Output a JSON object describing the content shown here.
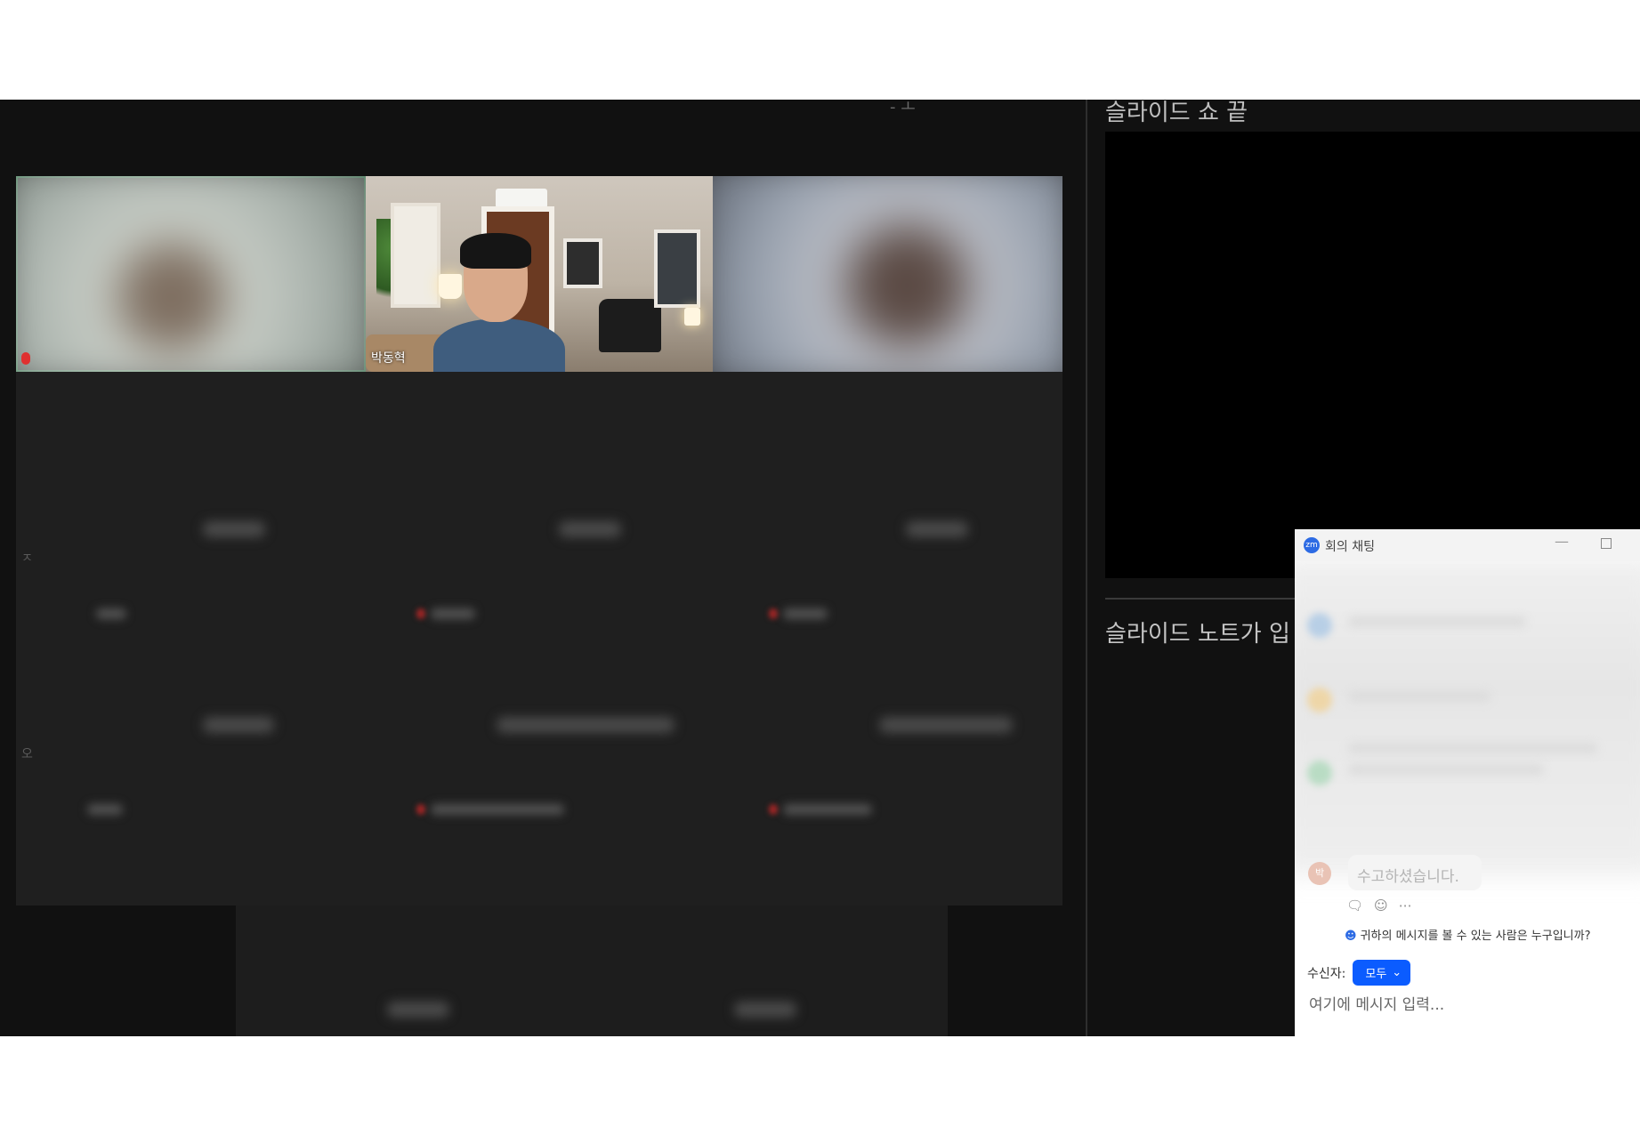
{
  "gallery": {
    "top_fragment": "- ㅗ",
    "participants": [
      {
        "name": "박동혁"
      }
    ],
    "side_marks": [
      "ㅈ",
      "오"
    ]
  },
  "presenter": {
    "end_title": "슬라이드 쇼 끝",
    "notes_title": "슬라이드 노트가 입"
  },
  "chat": {
    "app_icon_text": "zm",
    "title": "회의 채팅",
    "last_message": "수고하셨습니다.",
    "last_avatar": "박",
    "who_can_see": "귀하의 메시지를 볼 수 있는 사람은 누구입니까?",
    "recipient_label": "수신자:",
    "recipient_value": "모두",
    "input_placeholder": "여기에 메시지 입력..."
  },
  "colors": {
    "accent_blue": "#0b5cff",
    "active_speaker_green": "#1f8f4a",
    "muted_red": "#e03030"
  }
}
